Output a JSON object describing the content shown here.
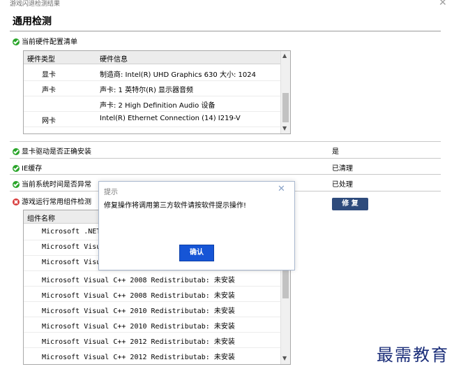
{
  "window": {
    "title": "游戏闪退检测结果",
    "close": "✕"
  },
  "heading": "通用检测",
  "hardware": {
    "label": "当前硬件配置清单",
    "headers": [
      "硬件类型",
      "硬件信息"
    ],
    "rows": [
      {
        "type": "显卡",
        "info": "制造商: Intel(R) UHD Graphics 630 大小: 1024"
      },
      {
        "type": "声卡",
        "info": "声卡: 1 英特尔(R) 显示器音频"
      },
      {
        "type": "",
        "info": "声卡: 2 High Definition Audio 设备"
      },
      {
        "type": "网卡",
        "info": "Intel(R) Ethernet Connection (14) I219-V"
      }
    ]
  },
  "checks": [
    {
      "label": "显卡驱动是否正确安装",
      "value": "是"
    },
    {
      "label": "IE缓存",
      "value": "已清理"
    },
    {
      "label": "当前系统时间是否异常",
      "value": "已处理"
    }
  ],
  "components": {
    "label": "游戏运行常用组件检测",
    "repair_button": "修 复",
    "header": "组件名称",
    "rows": [
      "Microsoft .NET",
      "Microsoft Visual",
      "Microsoft Visual",
      "Microsoft Visual C++ 2008 Redistributab: 未安装",
      "Microsoft Visual C++ 2008 Redistributab: 未安装",
      "Microsoft Visual C++ 2010 Redistributab: 未安装",
      "Microsoft Visual C++ 2010 Redistributab: 未安装",
      "Microsoft Visual C++ 2012 Redistributab: 未安装",
      "Microsoft Visual C++ 2012 Redistributab: 未安装"
    ]
  },
  "dialog": {
    "title": "提示",
    "close": "✕",
    "message": "修复操作将调用第三方软件请按软件提示操作!",
    "ok": "确认"
  },
  "watermark": "最需教育",
  "icons": {
    "ok": "check-circle-icon",
    "error": "error-circle-icon"
  },
  "colors": {
    "ok": "#2aa52a",
    "error": "#d83b3b",
    "repair": "#2e4b7c",
    "confirm": "#1655d6"
  }
}
